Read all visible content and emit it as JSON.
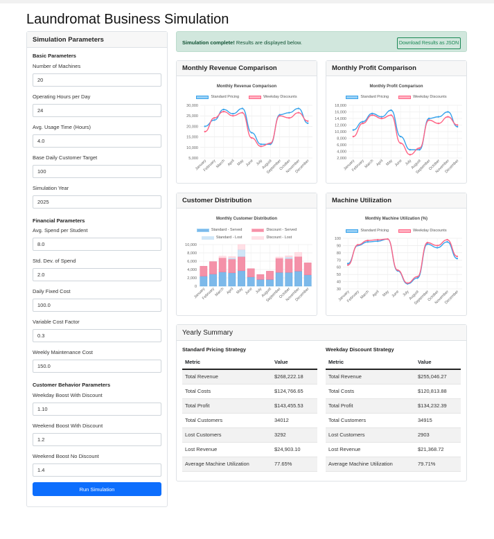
{
  "page_title": "Laundromat Business Simulation",
  "params": {
    "header": "Simulation Parameters",
    "sections": [
      {
        "title": "Basic Parameters",
        "fields": [
          {
            "label": "Number of Machines",
            "value": "20"
          },
          {
            "label": "Operating Hours per Day",
            "value": "24"
          },
          {
            "label": "Avg. Usage Time (Hours)",
            "value": "4.0"
          },
          {
            "label": "Base Daily Customer Target",
            "value": "100"
          },
          {
            "label": "Simulation Year",
            "value": "2025"
          }
        ]
      },
      {
        "title": "Financial Parameters",
        "fields": [
          {
            "label": "Avg. Spend per Student",
            "value": "8.0"
          },
          {
            "label": "Std. Dev. of Spend",
            "value": "2.0"
          },
          {
            "label": "Daily Fixed Cost",
            "value": "100.0"
          },
          {
            "label": "Variable Cost Factor",
            "value": "0.3"
          },
          {
            "label": "Weekly Maintenance Cost",
            "value": "150.0"
          }
        ]
      },
      {
        "title": "Customer Behavior Parameters",
        "fields": [
          {
            "label": "Weekday Boost With Discount",
            "value": "1.10"
          },
          {
            "label": "Weekend Boost With Discount",
            "value": "1.2"
          },
          {
            "label": "Weekend Boost No Discount",
            "value": "1.4"
          }
        ]
      }
    ],
    "run_label": "Run Simulation"
  },
  "alert": {
    "strong": "Simulation complete!",
    "text": " Results are displayed below.",
    "button": "Download Results as JSON"
  },
  "colors": {
    "standard": "#36a2eb",
    "discount": "#ff6384",
    "standard_fill": "#9ad0f5",
    "discount_fill": "#ffb1c1",
    "standard_lost": "#cfe6f7",
    "discount_lost": "#ffe0e6"
  },
  "months": [
    "January",
    "February",
    "March",
    "April",
    "May",
    "June",
    "July",
    "August",
    "September",
    "October",
    "November",
    "December"
  ],
  "charts": {
    "revenue": {
      "header": "Monthly Revenue Comparison"
    },
    "profit": {
      "header": "Monthly Profit Comparison"
    },
    "customers": {
      "header": "Customer Distribution"
    },
    "utilization": {
      "header": "Machine Utilization"
    }
  },
  "chart_data": [
    {
      "type": "line",
      "title": "Monthly Revenue Comparison",
      "categories": [
        "January",
        "February",
        "March",
        "April",
        "May",
        "June",
        "July",
        "August",
        "September",
        "October",
        "November",
        "December"
      ],
      "series": [
        {
          "name": "Standard Pricing",
          "values": [
            20000,
            23000,
            28000,
            26000,
            28500,
            17000,
            11500,
            11500,
            25500,
            26500,
            28500,
            21500
          ]
        },
        {
          "name": "Weekday Discounts",
          "values": [
            17500,
            24000,
            27000,
            25000,
            26500,
            14500,
            10500,
            12000,
            25000,
            24000,
            26500,
            22500
          ]
        }
      ],
      "ylim": [
        5000,
        30000
      ],
      "yticks": [
        "5,000",
        "10,000",
        "15,000",
        "20,000",
        "25,000",
        "30,000"
      ]
    },
    {
      "type": "line",
      "title": "Monthly Profit Comparison",
      "categories": [
        "January",
        "February",
        "March",
        "April",
        "May",
        "June",
        "July",
        "August",
        "September",
        "October",
        "November",
        "December"
      ],
      "series": [
        {
          "name": "Standard Pricing",
          "values": [
            10500,
            13000,
            15500,
            14500,
            16500,
            8500,
            4500,
            4500,
            14000,
            14500,
            16000,
            11500
          ]
        },
        {
          "name": "Weekday Discounts",
          "values": [
            8500,
            12500,
            15000,
            14000,
            15000,
            6500,
            3000,
            5000,
            13500,
            12500,
            14500,
            12000
          ]
        }
      ],
      "ylim": [
        2000,
        18000
      ],
      "yticks": [
        "2,000",
        "4,000",
        "6,000",
        "8,000",
        "10,000",
        "12,000",
        "14,000",
        "16,000",
        "18,000"
      ]
    },
    {
      "type": "bar",
      "stacked": true,
      "title": "Monthly Customer Distribution",
      "categories": [
        "January",
        "February",
        "March",
        "April",
        "May",
        "June",
        "July",
        "August",
        "September",
        "October",
        "November",
        "December"
      ],
      "series": [
        {
          "name": "Standard - Served",
          "values": [
            2400,
            2900,
            3400,
            3200,
            3700,
            2200,
            1600,
            1600,
            3300,
            3300,
            3600,
            2700
          ]
        },
        {
          "name": "Discount - Served",
          "values": [
            2400,
            3000,
            3400,
            3300,
            3400,
            2000,
            1200,
            2000,
            3400,
            3300,
            3500,
            2900
          ]
        },
        {
          "name": "Standard - Lost",
          "values": [
            0,
            0,
            0,
            300,
            1700,
            0,
            0,
            0,
            0,
            400,
            0,
            0
          ]
        },
        {
          "name": "Discount - Lost",
          "values": [
            0,
            0,
            400,
            300,
            1200,
            0,
            0,
            0,
            300,
            300,
            1000,
            0
          ]
        }
      ],
      "ylim": [
        0,
        10000
      ],
      "yticks": [
        "0",
        "2,000",
        "4,000",
        "6,000",
        "8,000",
        "10,000"
      ]
    },
    {
      "type": "line",
      "title": "Monthly Machine Utilization (%)",
      "categories": [
        "January",
        "February",
        "March",
        "April",
        "May",
        "June",
        "July",
        "August",
        "September",
        "October",
        "November",
        "December"
      ],
      "series": [
        {
          "name": "Standard Pricing",
          "values": [
            65,
            90,
            95,
            96,
            99,
            55,
            37,
            45,
            92,
            87,
            95,
            72
          ]
        },
        {
          "name": "Weekday Discounts",
          "values": [
            63,
            91,
            97,
            98,
            99,
            56,
            38,
            47,
            94,
            90,
            98,
            75
          ]
        }
      ],
      "ylim": [
        30,
        100
      ],
      "yticks": [
        "30",
        "40",
        "50",
        "60",
        "70",
        "80",
        "90",
        "100"
      ]
    }
  ],
  "chart_titles": {
    "revenue": "Monthly Revenue Comparison",
    "profit": "Monthly Profit Comparison",
    "customers": "Monthly Customer Distribution",
    "utilization": "Monthly Machine Utilization (%)"
  },
  "legends": {
    "pricing": [
      "Standard Pricing",
      "Weekday Discounts"
    ],
    "customers": [
      "Standard - Served",
      "Discount - Served",
      "Standard - Lost",
      "Discount - Lost"
    ]
  },
  "summary": {
    "header": "Yearly Summary",
    "col_metric": "Metric",
    "col_value": "Value",
    "standard": {
      "title": "Standard Pricing Strategy",
      "rows": [
        {
          "metric": "Total Revenue",
          "value": "$268,222.18"
        },
        {
          "metric": "Total Costs",
          "value": "$124,766.65"
        },
        {
          "metric": "Total Profit",
          "value": "$143,455.53"
        },
        {
          "metric": "Total Customers",
          "value": "34012"
        },
        {
          "metric": "Lost Customers",
          "value": "3292"
        },
        {
          "metric": "Lost Revenue",
          "value": "$24,903.10"
        },
        {
          "metric": "Average Machine Utilization",
          "value": "77.65%"
        }
      ]
    },
    "discount": {
      "title": "Weekday Discount Strategy",
      "rows": [
        {
          "metric": "Total Revenue",
          "value": "$255,046.27"
        },
        {
          "metric": "Total Costs",
          "value": "$120,813.88"
        },
        {
          "metric": "Total Profit",
          "value": "$134,232.39"
        },
        {
          "metric": "Total Customers",
          "value": "34915"
        },
        {
          "metric": "Lost Customers",
          "value": "2903"
        },
        {
          "metric": "Lost Revenue",
          "value": "$21,368.72"
        },
        {
          "metric": "Average Machine Utilization",
          "value": "79.71%"
        }
      ]
    }
  }
}
